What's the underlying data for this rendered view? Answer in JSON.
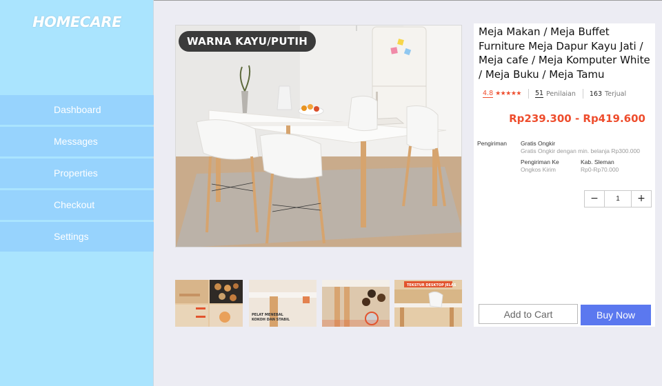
{
  "sidebar": {
    "brand": "HOMECARE",
    "items": [
      {
        "label": "Dashboard"
      },
      {
        "label": "Messages"
      },
      {
        "label": "Properties"
      },
      {
        "label": "Checkout"
      },
      {
        "label": "Settings"
      }
    ]
  },
  "product": {
    "image_badge": "WARNA KAYU/PUTIH",
    "title": "Meja Makan / Meja Buffet Furniture Meja Dapur Kayu Jati / Meja cafe / Meja Komputer White / Meja Buku / Meja Tamu",
    "rating": "4.8",
    "stars": "★★★★★",
    "reviews_count": "51",
    "reviews_label": "Penilaian",
    "sold_count": "163",
    "sold_label": "Terjual",
    "price": "Rp239.300 - Rp419.600",
    "shipping": {
      "label": "Pengiriman",
      "free_title": "Gratis Ongkir",
      "free_desc": "Gratis Ongkir dengan min. belanja Rp300.000",
      "to_label": "Pengiriman Ke",
      "to_value": "Kab. Sleman",
      "cost_label": "Ongkos Kirim",
      "cost_value": "Rp0-Rp70.000"
    },
    "quantity": "1",
    "thumbnails": [
      {
        "caption": ""
      },
      {
        "caption": "PELAT MENEBAL KOKOH DAN STABIL"
      },
      {
        "caption": ""
      },
      {
        "caption": "TEKSTUR DESKTOP JELAS"
      }
    ]
  },
  "actions": {
    "decrement": "−",
    "increment": "+",
    "add_to_cart": "Add to Cart",
    "buy_now": "Buy Now"
  },
  "colors": {
    "sidebar_bg": "#aae4fe",
    "nav_item_bg": "#97d3fd",
    "price": "#ee4d2d",
    "buy_button": "#5b78ef"
  }
}
